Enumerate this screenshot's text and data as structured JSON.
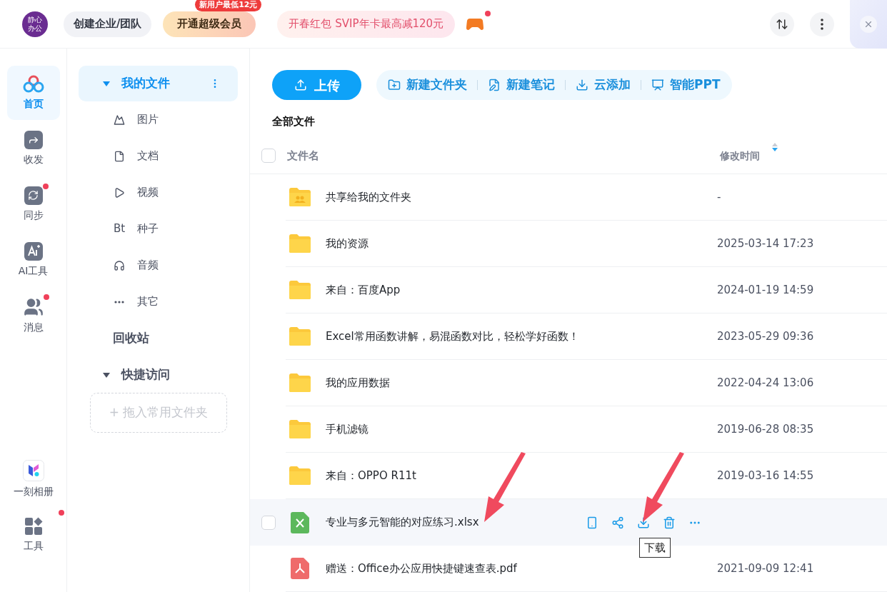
{
  "top_bar": {
    "avatar_lines": [
      "静心",
      "办公"
    ],
    "team_button": "创建企业/团队",
    "vip_button": {
      "label": "开通超级会员",
      "badge": "新用户最低12元"
    },
    "promo": "开春红包 SVIP年卡最高减120元",
    "game_dot": true
  },
  "rail": [
    {
      "label": "首页",
      "kind": "home",
      "selected": true,
      "badge": false
    },
    {
      "label": "收发",
      "kind": "share",
      "selected": false,
      "badge": false
    },
    {
      "label": "同步",
      "kind": "sync",
      "selected": false,
      "badge": true
    },
    {
      "label": "AI工具",
      "kind": "ai",
      "selected": false,
      "badge": false
    },
    {
      "label": "消息",
      "kind": "message",
      "selected": false,
      "badge": true
    }
  ],
  "rail_bottom": [
    {
      "label": "一刻相册",
      "kind": "album"
    },
    {
      "label": "工具",
      "kind": "tools",
      "badge": true
    }
  ],
  "nav": {
    "my_files": {
      "label": "我的文件",
      "selected": true,
      "expanded": true,
      "children": [
        {
          "label": "图片",
          "kind": "image"
        },
        {
          "label": "文档",
          "kind": "doc"
        },
        {
          "label": "视频",
          "kind": "video"
        },
        {
          "label": "种子",
          "kind": "torrent",
          "glyph": "Bt"
        },
        {
          "label": "音频",
          "kind": "audio"
        },
        {
          "label": "其它",
          "kind": "other"
        }
      ]
    },
    "recycle": "回收站",
    "quick": {
      "label": "快捷访问",
      "expanded": true,
      "drop_zone": "+ 拖入常用文件夹"
    }
  },
  "toolbar": {
    "upload": "上传",
    "actions": [
      {
        "label": "新建文件夹",
        "kind": "new-folder"
      },
      {
        "label": "新建笔记",
        "kind": "note"
      },
      {
        "label": "云添加",
        "kind": "cloud-add"
      },
      {
        "label": "智能PPT",
        "kind": "ppt"
      }
    ]
  },
  "breadcrumb": "全部文件",
  "table": {
    "select_all": {
      "checked": false
    },
    "columns": [
      "文件名",
      "修改时间"
    ],
    "rows": [
      {
        "name": "共享给我的文件夹",
        "kind": "shared-folder",
        "time": "-",
        "hovered": false
      },
      {
        "name": "我的资源",
        "kind": "folder",
        "time": "2025-03-14 17:23",
        "hovered": false
      },
      {
        "name": "来自：百度App",
        "kind": "folder",
        "time": "2024-01-19 14:59",
        "hovered": false
      },
      {
        "name": "Excel常用函数讲解，易混函数对比，轻松学好函数！",
        "kind": "folder",
        "time": "2023-05-29 09:36",
        "hovered": false
      },
      {
        "name": "我的应用数据",
        "kind": "folder",
        "time": "2022-04-24 13:06",
        "hovered": false
      },
      {
        "name": "手机滤镜",
        "kind": "folder",
        "time": "2019-06-28 08:35",
        "hovered": false
      },
      {
        "name": "来自：OPPO R11t",
        "kind": "folder",
        "time": "2019-03-16 14:55",
        "hovered": false
      },
      {
        "name": "专业与多元智能的对应练习.xlsx",
        "kind": "xlsx",
        "hovered": true,
        "tooltip": "下载"
      },
      {
        "name": "赠送：Office办公应用快捷键速查表.pdf",
        "kind": "pdf",
        "time": "2021-09-09 12:41",
        "hovered": false
      }
    ]
  }
}
